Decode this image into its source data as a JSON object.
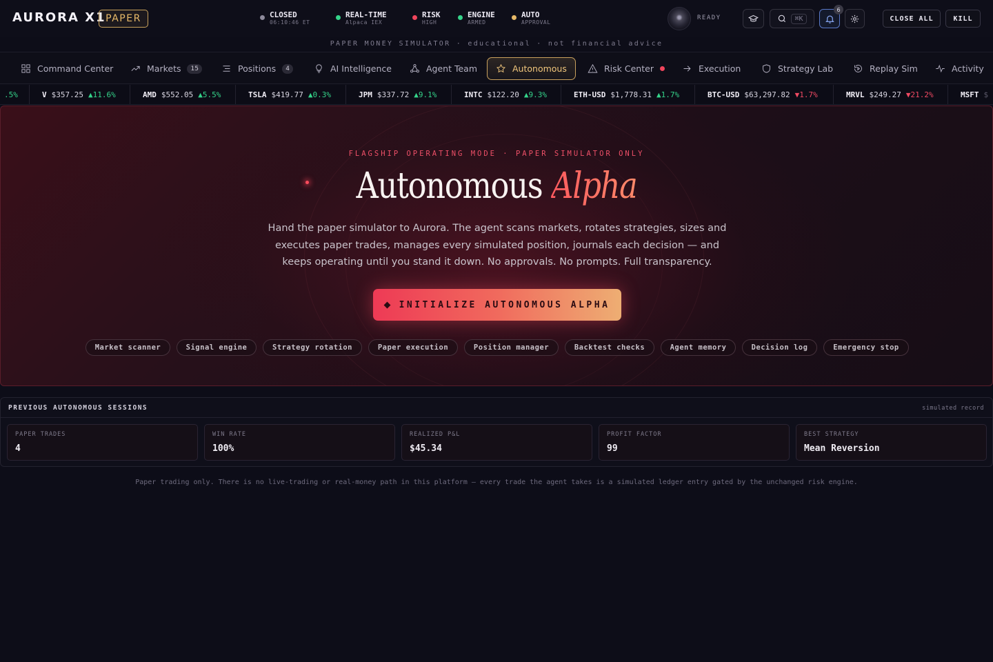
{
  "brand": {
    "name": "AURORA X1",
    "mode_badge": "PAPER"
  },
  "statuses": [
    {
      "label": "CLOSED",
      "sub": "06:10:46 ET",
      "color": "#8d8a9b"
    },
    {
      "label": "REAL-TIME",
      "sub": "Alpaca IEX",
      "color": "#35d48a"
    },
    {
      "label": "RISK",
      "sub": "HIGH",
      "color": "#f0455c"
    },
    {
      "label": "ENGINE",
      "sub": "ARMED",
      "color": "#35d48a"
    },
    {
      "label": "AUTO",
      "sub": "APPROVAL",
      "color": "#e7b968"
    }
  ],
  "agent_status": "READY",
  "search": {
    "shortcut": "⌘K"
  },
  "notifications": {
    "count": "6"
  },
  "actions": {
    "close_all": "CLOSE ALL",
    "kill": "KILL"
  },
  "sim_banner": "PAPER MONEY SIMULATOR · educational · not financial advice",
  "nav": [
    {
      "label": "Command Center",
      "icon": "grid-icon"
    },
    {
      "label": "Markets",
      "icon": "trend-icon",
      "count": "15"
    },
    {
      "label": "Positions",
      "icon": "list-icon",
      "count": "4"
    },
    {
      "label": "AI Intelligence",
      "icon": "bulb-icon"
    },
    {
      "label": "Agent Team",
      "icon": "network-icon"
    },
    {
      "label": "Autonomous",
      "icon": "star-icon",
      "active": true
    },
    {
      "label": "Risk Center",
      "icon": "warning-icon",
      "alert": true
    },
    {
      "label": "Execution",
      "icon": "arrow-right-icon"
    },
    {
      "label": "Strategy Lab",
      "icon": "shield-icon"
    },
    {
      "label": "Replay Sim",
      "icon": "replay-icon"
    },
    {
      "label": "Activity",
      "icon": "pulse-icon"
    }
  ],
  "ticker": [
    {
      "symbol": "",
      "price": "",
      "change": ".5%",
      "dir": "up"
    },
    {
      "symbol": "V",
      "price": "$357.25",
      "change": "▲11.6%",
      "dir": "up"
    },
    {
      "symbol": "AMD",
      "price": "$552.05",
      "change": "▲5.5%",
      "dir": "up"
    },
    {
      "symbol": "TSLA",
      "price": "$419.77",
      "change": "▲0.3%",
      "dir": "up"
    },
    {
      "symbol": "JPM",
      "price": "$337.72",
      "change": "▲9.1%",
      "dir": "up"
    },
    {
      "symbol": "INTC",
      "price": "$122.20",
      "change": "▲9.3%",
      "dir": "up"
    },
    {
      "symbol": "ETH-USD",
      "price": "$1,778.31",
      "change": "▲1.7%",
      "dir": "up"
    },
    {
      "symbol": "BTC-USD",
      "price": "$63,297.82",
      "change": "▼1.7%",
      "dir": "dn"
    },
    {
      "symbol": "MRVL",
      "price": "$249.27",
      "change": "▼21.2%",
      "dir": "dn"
    },
    {
      "symbol": "MSFT",
      "price": "$",
      "change": "",
      "dir": "up"
    }
  ],
  "hero": {
    "kicker": "FLAGSHIP OPERATING MODE · PAPER SIMULATOR ONLY",
    "title_main": "Autonomous",
    "title_accent": "Alpha",
    "description": "Hand the paper simulator to Aurora. The agent scans markets, rotates strategies, sizes and executes paper trades, manages every simulated position, journals each decision — and keeps operating until you stand it down. No approvals. No prompts. Full transparency.",
    "cta": "INITIALIZE AUTONOMOUS ALPHA",
    "chips": [
      "Market scanner",
      "Signal engine",
      "Strategy rotation",
      "Paper execution",
      "Position manager",
      "Backtest checks",
      "Agent memory",
      "Decision log",
      "Emergency stop"
    ]
  },
  "sessions": {
    "title": "PREVIOUS AUTONOMOUS SESSIONS",
    "note": "simulated record",
    "stats": [
      {
        "label": "PAPER TRADES",
        "value": "4"
      },
      {
        "label": "WIN RATE",
        "value": "100%"
      },
      {
        "label": "REALIZED P&L",
        "value": "$45.34"
      },
      {
        "label": "PROFIT FACTOR",
        "value": "99"
      },
      {
        "label": "BEST STRATEGY",
        "value": "Mean Reversion"
      }
    ]
  },
  "footer_note": "Paper trading only. There is no live-trading or real-money path in this platform — every trade the agent takes is a simulated ledger entry gated by the unchanged risk engine."
}
